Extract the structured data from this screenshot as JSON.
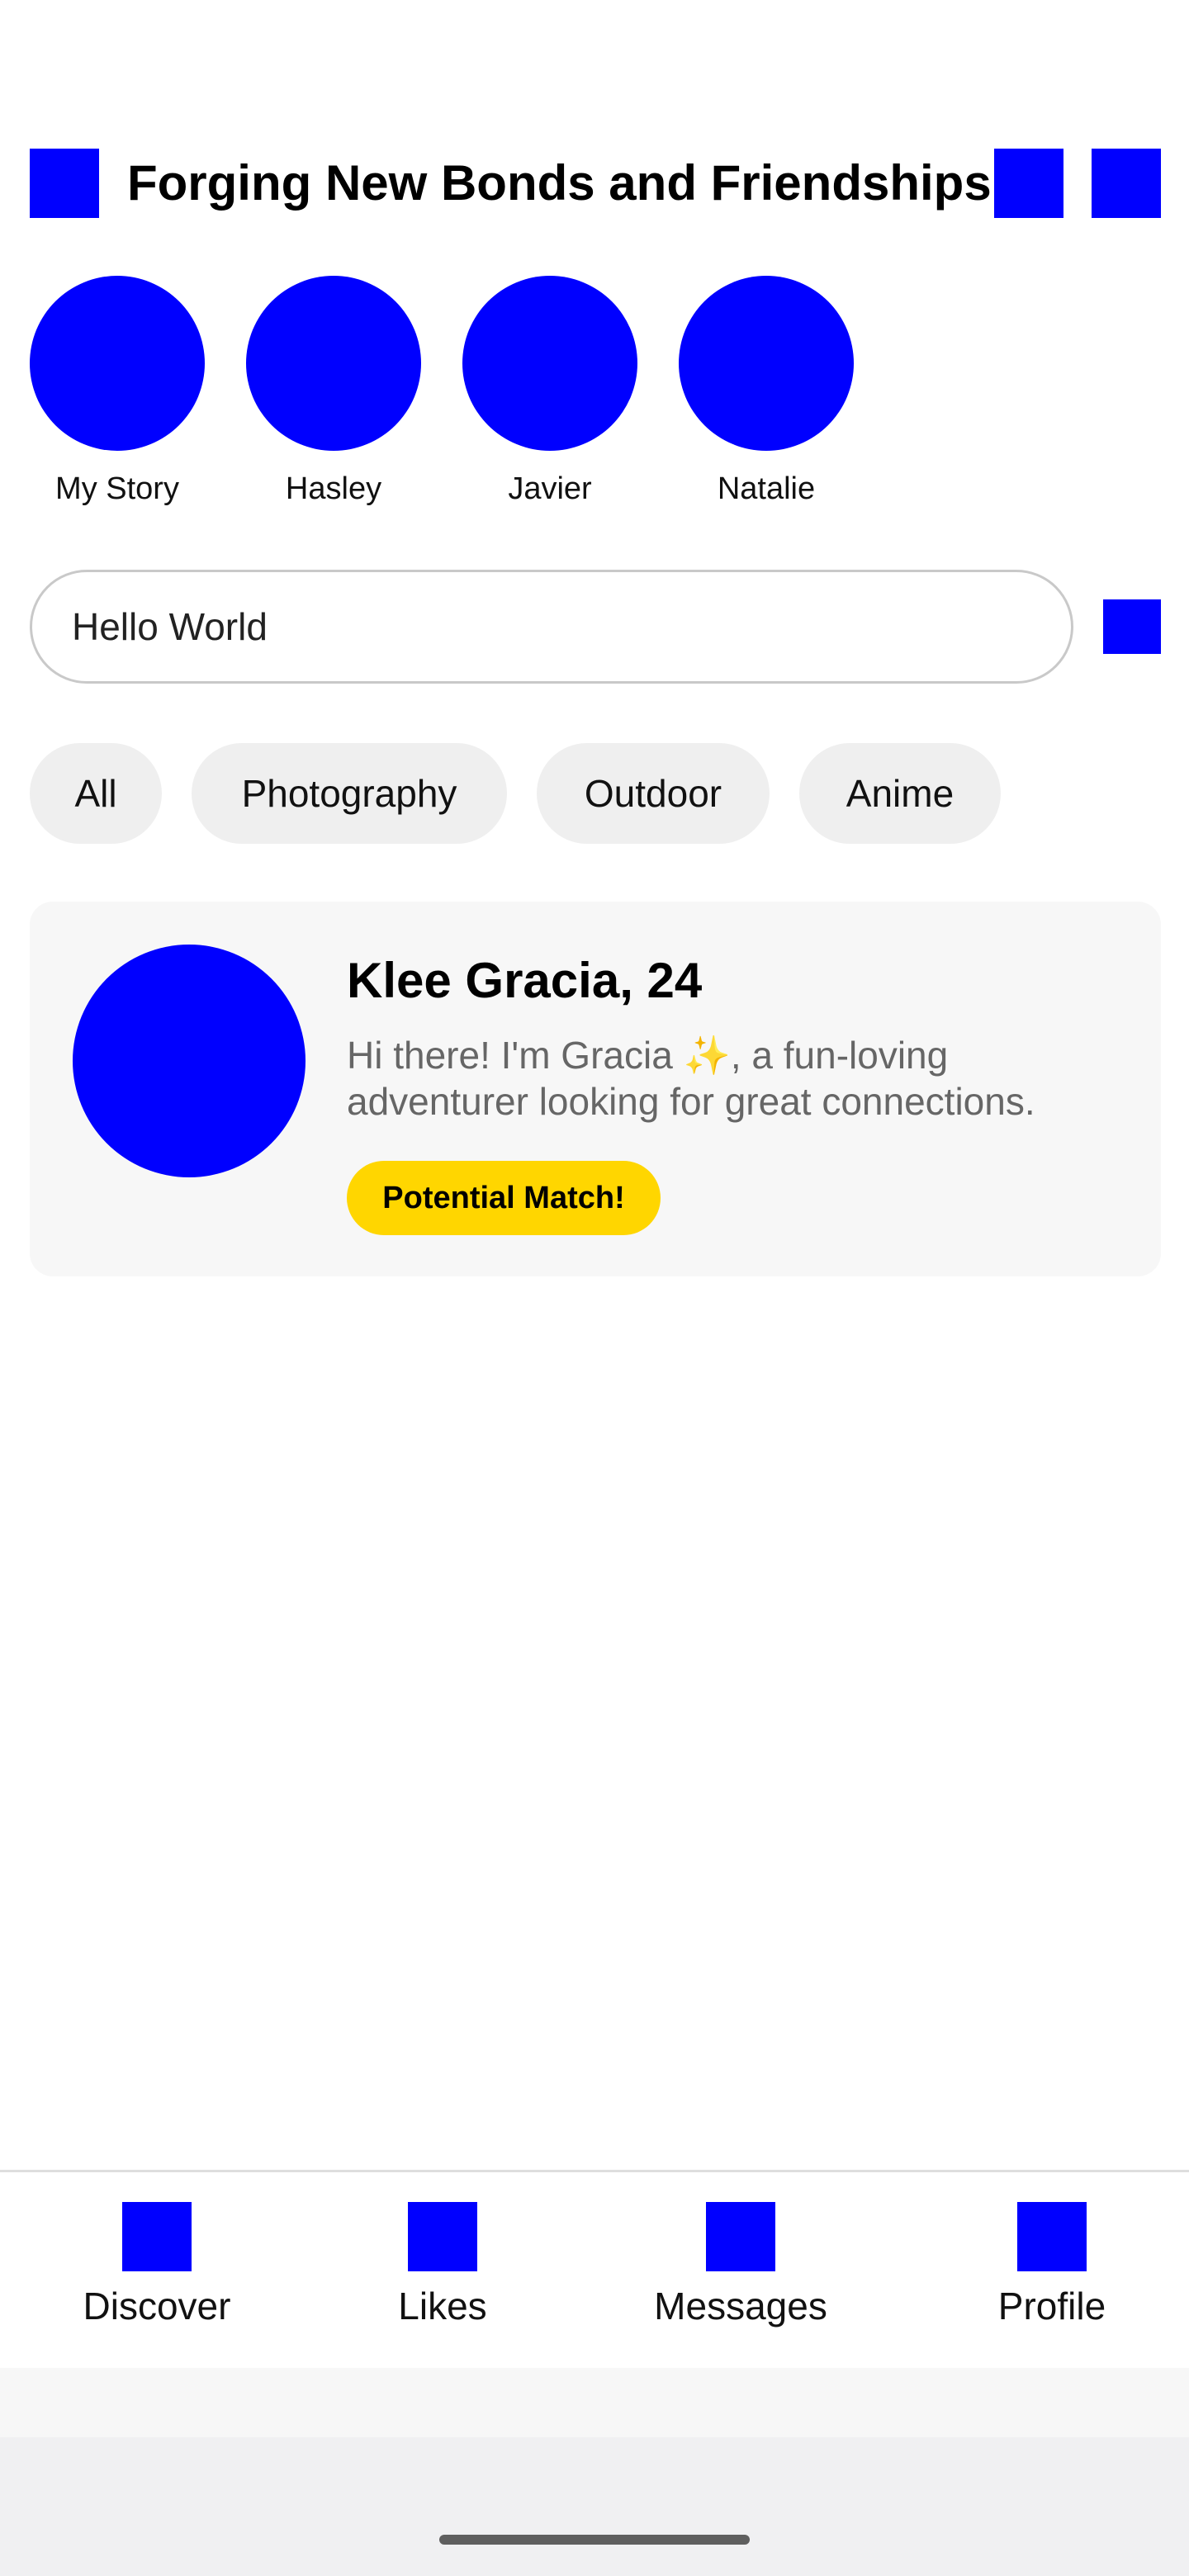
{
  "header": {
    "title": "Forging New Bonds and Friendships",
    "left_icon": "menu-icon",
    "right_icons": [
      "notification-icon",
      "settings-icon"
    ]
  },
  "stories": [
    {
      "label": "My Story"
    },
    {
      "label": "Hasley"
    },
    {
      "label": "Javier"
    },
    {
      "label": "Natalie"
    }
  ],
  "search": {
    "value": "Hello World",
    "button_icon": "filter-icon"
  },
  "chips": [
    "All",
    "Photography",
    "Outdoor",
    "Anime"
  ],
  "match_card": {
    "name": "Klee Gracia, 24",
    "bio": "Hi there! I'm Gracia ✨, a fun-loving adventurer looking for great connections.",
    "badge": "Potential Match!"
  },
  "bottom_nav": [
    {
      "label": "Discover",
      "icon": "discover-icon"
    },
    {
      "label": "Likes",
      "icon": "heart-icon"
    },
    {
      "label": "Messages",
      "icon": "chat-icon"
    },
    {
      "label": "Profile",
      "icon": "user-icon"
    }
  ],
  "colors": {
    "placeholder_blue": "#0000ff",
    "badge_yellow": "#ffd600",
    "chip_bg": "#efefef",
    "card_bg": "#f7f7f7"
  }
}
